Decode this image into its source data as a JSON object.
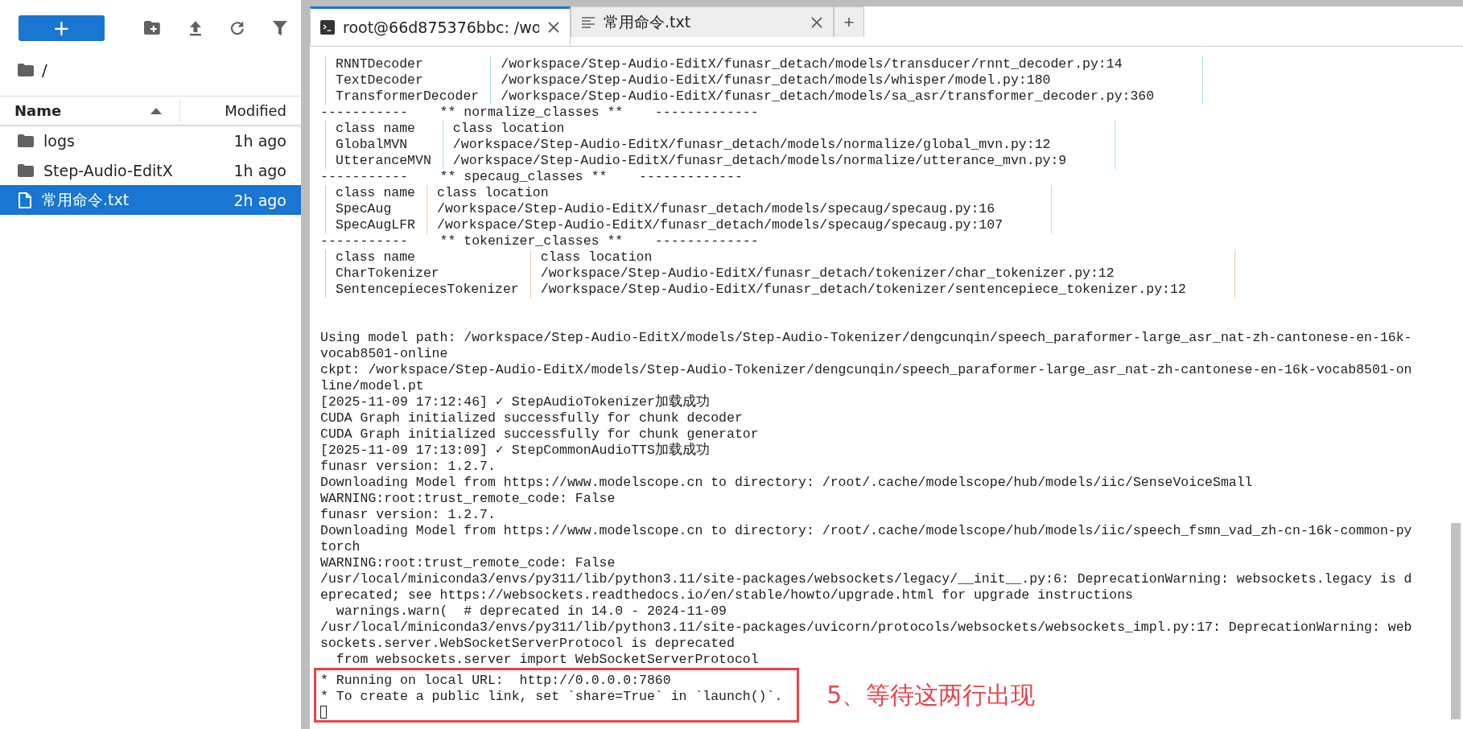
{
  "file_browser": {
    "new_button": {
      "label": "+"
    },
    "breadcrumb": "/",
    "columns": [
      {
        "label": "Name",
        "sorted": true
      },
      {
        "label": "Modified",
        "sorted": false
      }
    ],
    "files": [
      {
        "name": "logs",
        "kind": "folder",
        "modified": "1h ago",
        "selected": false
      },
      {
        "name": "Step-Audio-EditX",
        "kind": "folder",
        "modified": "1h ago",
        "selected": false
      },
      {
        "name": "常用命令.txt",
        "kind": "file",
        "modified": "2h ago",
        "selected": true
      }
    ]
  },
  "tabs": [
    {
      "label": "root@66d875376bbc: /wo",
      "kind": "terminal",
      "selected": true
    },
    {
      "label": "常用命令.txt",
      "kind": "text",
      "selected": false
    }
  ],
  "add_tab": "+",
  "terminal": {
    "blocks": [
      {
        "kind": "table",
        "color": "#a6dcec",
        "rows": [
          [
            "RNNTDecoder",
            "/workspace/Step-Audio-EditX/funasr_detach/models/transducer/rnnt_decoder.py:14"
          ],
          [
            "TextDecoder",
            "/workspace/Step-Audio-EditX/funasr_detach/models/whisper/model.py:180"
          ],
          [
            "TransformerDecoder",
            "/workspace/Step-Audio-EditX/funasr_detach/models/sa_asr/transformer_decoder.py:360"
          ]
        ]
      },
      {
        "kind": "line",
        "text": "-----------    ** normalize_classes **    -------------"
      },
      {
        "kind": "table",
        "color": "#a6dcec",
        "rows": [
          [
            "class name",
            "class location"
          ],
          [
            "GlobalMVN",
            "/workspace/Step-Audio-EditX/funasr_detach/models/normalize/global_mvn.py:12"
          ],
          [
            "UtteranceMVN",
            "/workspace/Step-Audio-EditX/funasr_detach/models/normalize/utterance_mvn.py:9"
          ]
        ]
      },
      {
        "kind": "line",
        "text": "-----------    ** specaug_classes **    -------------"
      },
      {
        "kind": "table",
        "color": "#f2c9a8",
        "rows": [
          [
            "class name",
            "class location"
          ],
          [
            "SpecAug",
            "/workspace/Step-Audio-EditX/funasr_detach/models/specaug/specaug.py:16"
          ],
          [
            "SpecAugLFR",
            "/workspace/Step-Audio-EditX/funasr_detach/models/specaug/specaug.py:107"
          ]
        ]
      },
      {
        "kind": "line",
        "text": "-----------    ** tokenizer_classes **    -------------"
      },
      {
        "kind": "table",
        "color": "#f2c9a8",
        "rows": [
          [
            "class name",
            "class location"
          ],
          [
            "CharTokenizer",
            "/workspace/Step-Audio-EditX/funasr_detach/tokenizer/char_tokenizer.py:12"
          ],
          [
            "SentencepiecesTokenizer",
            "/workspace/Step-Audio-EditX/funasr_detach/tokenizer/sentencepiece_tokenizer.py:12"
          ]
        ]
      },
      {
        "kind": "blank"
      },
      {
        "kind": "blank"
      },
      {
        "kind": "line",
        "text": "Using model path: /workspace/Step-Audio-EditX/models/Step-Audio-Tokenizer/dengcunqin/speech_paraformer-large_asr_nat-zh-cantonese-en-16k-"
      },
      {
        "kind": "line",
        "text": "vocab8501-online"
      },
      {
        "kind": "line",
        "text": "ckpt: /workspace/Step-Audio-EditX/models/Step-Audio-Tokenizer/dengcunqin/speech_paraformer-large_asr_nat-zh-cantonese-en-16k-vocab8501-on"
      },
      {
        "kind": "line",
        "text": "line/model.pt"
      },
      {
        "kind": "line",
        "text": "[2025-11-09 17:12:46] ✓ StepAudioTokenizer加载成功"
      },
      {
        "kind": "line",
        "text": "CUDA Graph initialized successfully for chunk decoder"
      },
      {
        "kind": "line",
        "text": "CUDA Graph initialized successfully for chunk generator"
      },
      {
        "kind": "line",
        "text": "[2025-11-09 17:13:09] ✓ StepCommonAudioTTS加载成功"
      },
      {
        "kind": "line",
        "text": "funasr version: 1.2.7."
      },
      {
        "kind": "line",
        "text": "Downloading Model from https://www.modelscope.cn to directory: /root/.cache/modelscope/hub/models/iic/SenseVoiceSmall"
      },
      {
        "kind": "line",
        "text": "WARNING:root:trust_remote_code: False"
      },
      {
        "kind": "line",
        "text": "funasr version: 1.2.7."
      },
      {
        "kind": "line",
        "text": "Downloading Model from https://www.modelscope.cn to directory: /root/.cache/modelscope/hub/models/iic/speech_fsmn_vad_zh-cn-16k-common-py"
      },
      {
        "kind": "line",
        "text": "torch"
      },
      {
        "kind": "line",
        "text": "WARNING:root:trust_remote_code: False"
      },
      {
        "kind": "line",
        "text": "/usr/local/miniconda3/envs/py311/lib/python3.11/site-packages/websockets/legacy/__init__.py:6: DeprecationWarning: websockets.legacy is d"
      },
      {
        "kind": "line",
        "text": "eprecated; see https://websockets.readthedocs.io/en/stable/howto/upgrade.html for upgrade instructions"
      },
      {
        "kind": "line",
        "text": "  warnings.warn(  # deprecated in 14.0 - 2024-11-09"
      },
      {
        "kind": "line",
        "text": "/usr/local/miniconda3/envs/py311/lib/python3.11/site-packages/uvicorn/protocols/websockets/websockets_impl.py:17: DeprecationWarning: web"
      },
      {
        "kind": "line",
        "text": "sockets.server.WebSocketServerProtocol is deprecated"
      },
      {
        "kind": "line",
        "text": "  from websockets.server import WebSocketServerProtocol"
      },
      {
        "kind": "highlight",
        "color": "#e8434a",
        "note": "5、等待这两行出现",
        "lines": [
          "* Running on local URL:  http://0.0.0.0:7860",
          "* To create a public link, set `share=True` in `launch()`."
        ]
      }
    ]
  }
}
